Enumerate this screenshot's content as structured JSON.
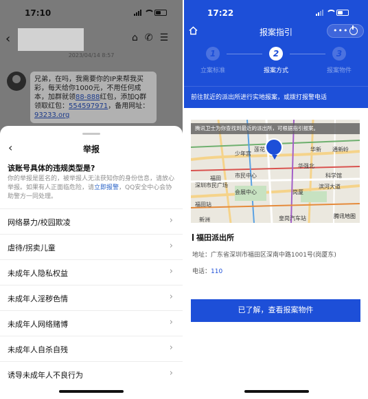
{
  "left": {
    "status_time": "17:10",
    "chat_timestamp": "2023/04/14 8:57",
    "message": {
      "text_before": "兄弟，在吗，我需要你的IP来帮我买彩，每天给你1000元，不用任何成本，加群就领",
      "link1": "88-888",
      "text_mid": "红包，添加Q群领取红包：",
      "link2": "554597971",
      "text_after": "，备用网址：",
      "link3": "93233.org"
    },
    "sheet": {
      "title": "举报",
      "question": "该账号具体的违规类型是?",
      "note_before": "你的举报是匿名的，被举报人无法获知你的身份信息，请放心举报。如果有人正面临危险，请",
      "note_link": "立即报警",
      "note_after": "，QQ安全中心会协助警方一同处理。",
      "categories": [
        "网络暴力/校园欺凌",
        "虐待/拐卖儿童",
        "未成年人隐私权益",
        "未成年人淫秽色情",
        "未成年人网络赌博",
        "未成年人自杀自残",
        "诱导未成年人不良行为"
      ]
    }
  },
  "right": {
    "status_time": "17:22",
    "title": "报案指引",
    "steps": [
      {
        "num": "1",
        "label": "立案标准"
      },
      {
        "num": "2",
        "label": "报案方式"
      },
      {
        "num": "3",
        "label": "报案物件"
      }
    ],
    "active_step": 2,
    "banner": "前往就近的派出所进行实地报案，或拨打报警电话",
    "map": {
      "toast": "腾讯卫士为你查找到最近的派出所，可根据指引报案。",
      "labels": [
        "少年宫",
        "莲花",
        "华新",
        "通新岭",
        "市民中心",
        "福田",
        "华强北",
        "科学馆",
        "深圳市民广场",
        "会展中心",
        "岗厦",
        "滨河大道",
        "福田站",
        "皇岗汽车站",
        "新洲"
      ],
      "attribution": "腾讯地图"
    },
    "station": {
      "name": "福田派出所",
      "address_label": "地址：",
      "address": "广东省深圳市福田区深南中路1001号(岗厦东)",
      "phone_label": "电话：",
      "phone": "110"
    },
    "cta": "已了解，查看报案物件"
  },
  "colors": {
    "primary_blue": "#1d4fd8",
    "overlay_gray": "#7a7a7a"
  }
}
